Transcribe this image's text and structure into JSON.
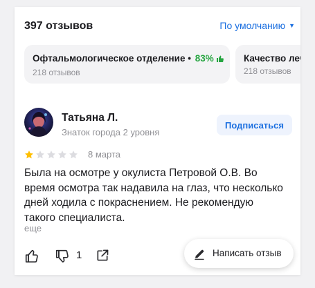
{
  "header": {
    "reviews_count": "397 отзывов",
    "sort_label": "По умолчанию",
    "sort_caret": "▼"
  },
  "categories": [
    {
      "title": "Офтальмологическое отделение",
      "separator": "•",
      "percent": "83%",
      "count": "218 отзывов"
    },
    {
      "title": "Качество лечения",
      "count": "218 отзывов"
    }
  ],
  "review": {
    "author_name": "Татьяна Л.",
    "author_level": "Знаток города 2 уровня",
    "subscribe_label": "Подписаться",
    "rating": 1,
    "rating_max": 5,
    "date": "8 марта",
    "text": "Была на осмотре у окулиста Петровой О.В. Во время осмотра так надавила на глаз, что несколько дней ходила с покраснением. Не рекомендую такого специалиста.",
    "more_label": "еще",
    "dislike_count": "1"
  },
  "write_review_label": "Написать отзыв",
  "colors": {
    "accent_blue": "#1b6fe0",
    "positive_green": "#26a541",
    "star_active": "#ffbf00",
    "star_inactive": "#dcdce0",
    "muted_text": "#8f8f94"
  },
  "icons": [
    "thumb-up-icon",
    "thumb-down-icon",
    "share-icon",
    "pen-icon",
    "chevron-down-icon"
  ]
}
